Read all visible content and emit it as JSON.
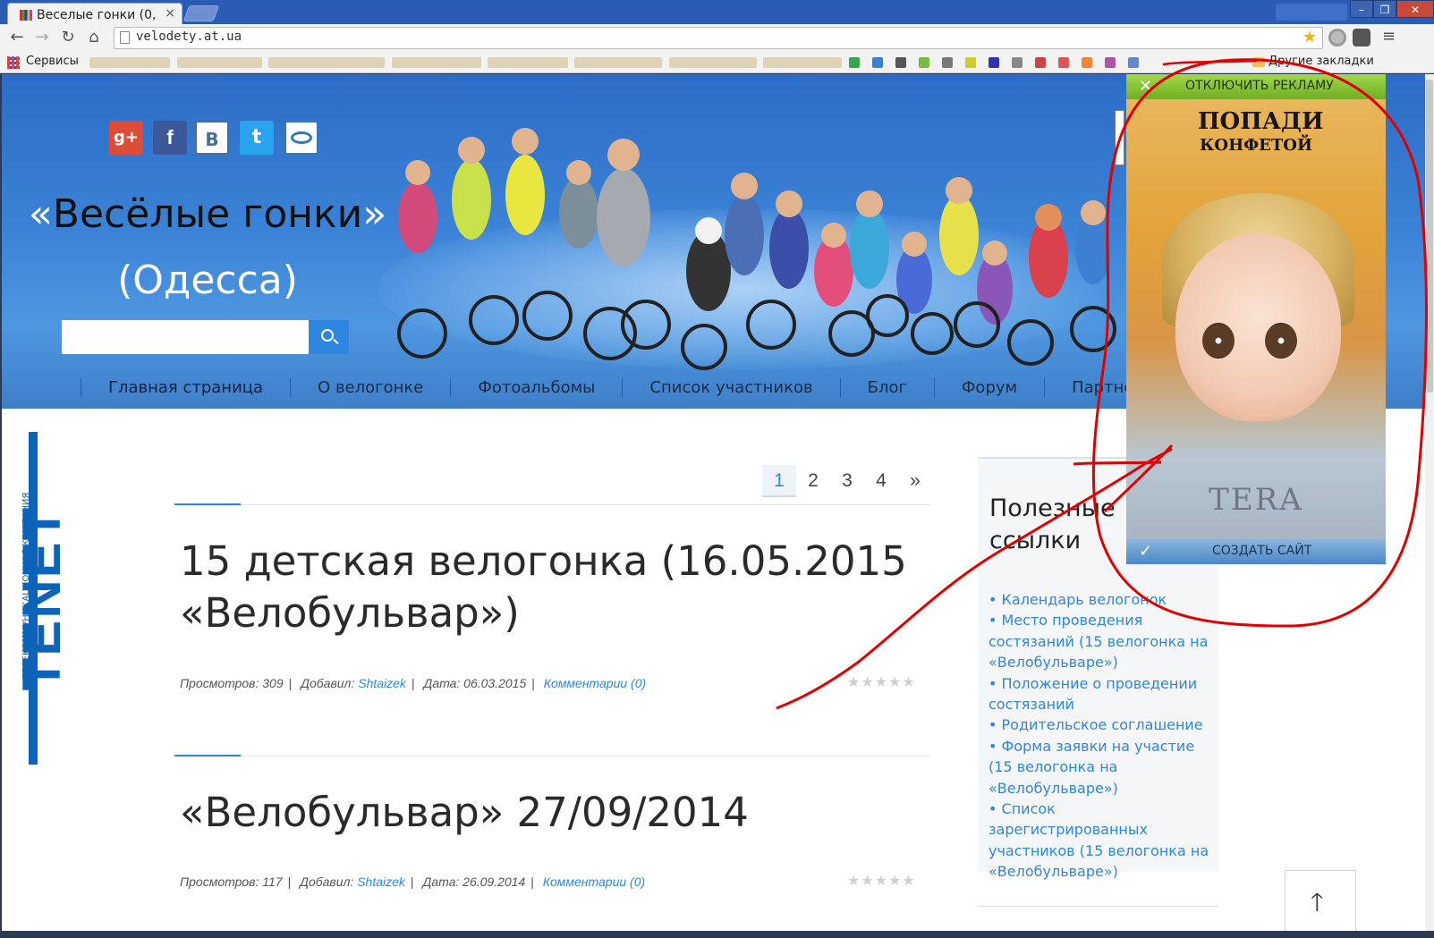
{
  "browser": {
    "tab_title": "Веселые гонки (0,",
    "tab_close": "×",
    "url": "velodety.at.ua",
    "bookmarks_services": "Сервисы",
    "bookmarks_other": "Другие закладки",
    "window_controls": {
      "minimize": "–",
      "maximize": "❐",
      "close": "✕"
    }
  },
  "header": {
    "social_icons": [
      "gplus-icon",
      "facebook-icon",
      "vk-icon",
      "twitter-icon",
      "lj-icon"
    ],
    "gplus_glyph": "g+",
    "facebook_glyph": "f",
    "vk_glyph": "B",
    "twitter_glyph": "t",
    "title_open_quote": "«",
    "title_main": "Весёлые гонки",
    "title_close_quote": "»",
    "title_line2": "(Одесса)",
    "search_value": ""
  },
  "nav": {
    "items": [
      "Главная страница",
      "О велогонке",
      "Фотоальбомы",
      "Список участников",
      "Блог",
      "Форум",
      "Партнеры"
    ]
  },
  "tenet": {
    "word": "TENET",
    "subtitle": "ТЕЛЕКОММУНИКАЦИОННАЯ КОМПАНИЯ"
  },
  "pagination": {
    "pages": [
      "1",
      "2",
      "3",
      "4",
      "»"
    ],
    "current": "1"
  },
  "posts": [
    {
      "title": "15 детская велогонка (16.05.2015 «Велобульвар»)",
      "views_label": "Просмотров: 309",
      "author_label": "Добавил:",
      "author": "Shtaizek",
      "date_label": "Дата: 06.03.2015",
      "comments": "Комментарии (0)",
      "rating_stars": 0
    },
    {
      "title": "«Велобульвар» 27/09/2014",
      "views_label": "Просмотров: 117",
      "author_label": "Добавил:",
      "author": "Shtaizek",
      "date_label": "Дата: 26.09.2014",
      "comments": "Комментарии (0)",
      "rating_stars": 0
    }
  ],
  "sidebar": {
    "title": "Полезные ссылки",
    "links": [
      "Календарь велогонок",
      "Место проведения состязаний (15 велогонка на «Велобульваре»)",
      "Положение о проведении состязаний",
      "Родительское соглашение",
      "Форма заявки на участие (15 велогонка на «Велобульваре»)",
      "Список зарегистрированных участников (15 велогонка на «Велобульваре»)"
    ]
  },
  "ad": {
    "disable_label": "ОТКЛЮЧИТЬ РЕКЛАМУ",
    "heading_line1": "ПОПАДИ",
    "heading_line2": "КОНФЕТОЙ",
    "logo": "TERA",
    "create_label": "СОЗДАТЬ САЙТ",
    "close_glyph": "✕",
    "check_glyph": "✓"
  },
  "scroll_top_glyph": "🡑",
  "colors": {
    "accent": "#2e86e0",
    "hero_blue": "#3a82d6",
    "ad_green": "#8cc63f",
    "annotation_red": "#e00000"
  }
}
